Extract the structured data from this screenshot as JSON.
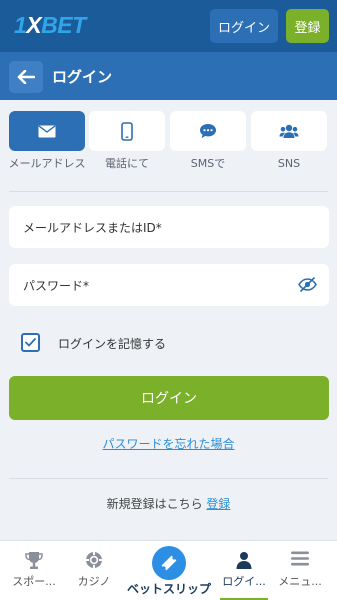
{
  "header": {
    "logo_one": "1",
    "logo_x": "X",
    "logo_bet": "BET",
    "login_label": "ログイン",
    "register_label": "登録"
  },
  "subheader": {
    "title": "ログイン",
    "back_icon": "arrow-left-icon"
  },
  "methods": [
    {
      "label": "メールアドレス",
      "icon": "envelope-icon",
      "active": true
    },
    {
      "label": "電話にて",
      "icon": "phone-icon",
      "active": false
    },
    {
      "label": "SMSで",
      "icon": "sms-bubble-icon",
      "active": false
    },
    {
      "label": "SNS",
      "icon": "people-icon",
      "active": false
    }
  ],
  "form": {
    "email_label": "メールアドレスまたはID*",
    "password_label": "パスワード*",
    "remember_label": "ログインを記憶する",
    "remember_checked": true,
    "submit_label": "ログイン",
    "forgot_label": "パスワードを忘れた場合",
    "register_prompt": "新規登録はこちら",
    "register_link": "登録"
  },
  "bottom_nav": {
    "items": [
      {
        "label": "スポー...",
        "icon": "trophy-icon"
      },
      {
        "label": "カジノ",
        "icon": "casino-chip-icon"
      },
      {
        "label": "ベットスリップ",
        "icon": "ticket-icon"
      },
      {
        "label": "ログイ...",
        "icon": "user-icon",
        "active": true
      },
      {
        "label": "メニュ...",
        "icon": "hamburger-menu-icon"
      }
    ]
  },
  "colors": {
    "header_bg": "#1b5b9a",
    "subheader_bg": "#2c6fb4",
    "accent_green": "#7bb12a",
    "link_blue": "#2c8fd6",
    "page_bg": "#eef1f5"
  }
}
